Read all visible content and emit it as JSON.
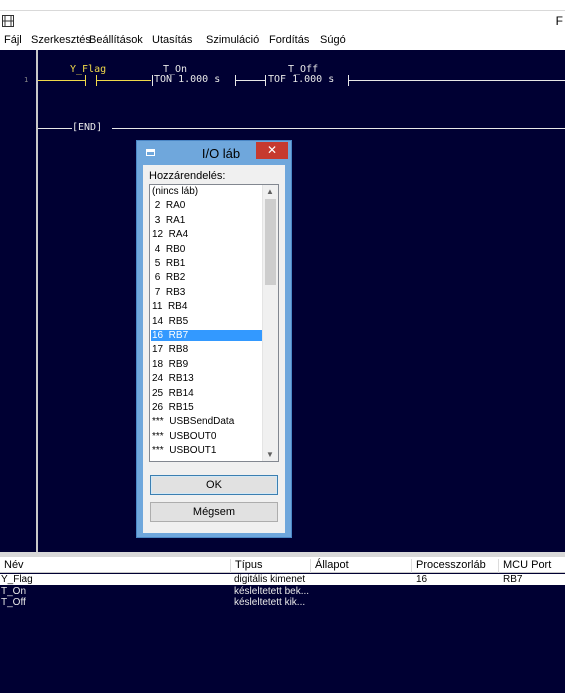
{
  "window": {
    "app_icon_name": "ladder-app-icon",
    "title_fragment": "F"
  },
  "menu": [
    {
      "label": "Fájl"
    },
    {
      "label": "Szerkesztés"
    },
    {
      "label": "Beállítások"
    },
    {
      "label": "Utasítás"
    },
    {
      "label": "Szimuláció"
    },
    {
      "label": "Fordítás"
    },
    {
      "label": "Súgó"
    }
  ],
  "ladder": {
    "rung_number": "1",
    "contact_name": "Y_Flag",
    "ton_name": "T_On",
    "ton_text": "TON 1.000 s",
    "tof_name": "T_Off",
    "tof_text": "TOF 1.000 s",
    "end_label": "[END]"
  },
  "dialog": {
    "title": "I/O láb",
    "close_glyph": "✕",
    "label": "Hozzárendelés:",
    "items": [
      "(nincs láb)",
      " 2  RA0",
      " 3  RA1",
      "12  RA4",
      " 4  RB0",
      " 5  RB1",
      " 6  RB2",
      " 7  RB3",
      "11  RB4",
      "14  RB5",
      "16  RB7",
      "17  RB8",
      "18  RB9",
      "24  RB13",
      "25  RB14",
      "26  RB15",
      "***  USBSendData",
      "***  USBOUT0",
      "***  USBOUT1"
    ],
    "selected_index": 10,
    "scroll_up_glyph": "▲",
    "scroll_down_glyph": "▼",
    "ok_label": "OK",
    "cancel_label": "Mégsem"
  },
  "io_table": {
    "columns": [
      "Név",
      "Típus",
      "Állapot",
      "Processzorláb",
      "MCU Port"
    ],
    "rows": [
      {
        "name": "Y_Flag",
        "type": "digitális kimenet",
        "state": "",
        "pin": "16",
        "port": "RB7"
      },
      {
        "name": "T_On",
        "type": "késleltetett bek...",
        "state": "",
        "pin": "",
        "port": ""
      },
      {
        "name": "T_Off",
        "type": "késleltetett kik...",
        "state": "",
        "pin": "",
        "port": ""
      }
    ],
    "selected_row": 0
  },
  "colors": {
    "editor_bg": "#000033",
    "ladder_yellow": "#f0d94a",
    "selection_blue": "#3399ff",
    "close_red": "#c63a2f"
  }
}
